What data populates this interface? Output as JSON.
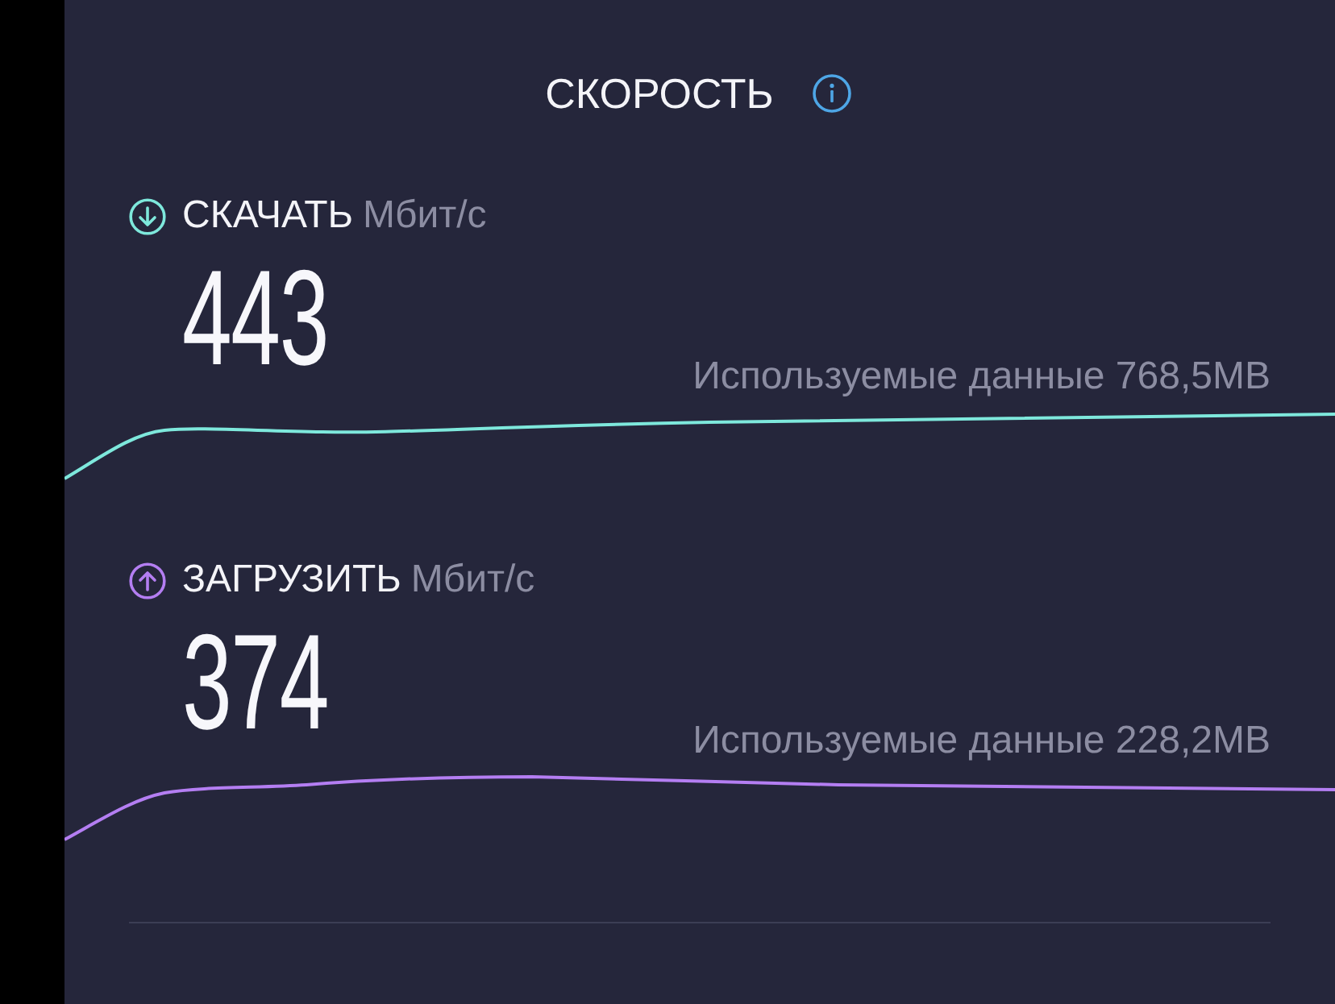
{
  "title": "СКОРОСТЬ",
  "speeds": [
    {
      "kind": "download",
      "label": "СКАЧАТЬ",
      "unit": "Мбит/с",
      "value": "443",
      "data_used": "Используемые данные 768,5MB",
      "color": "#7ee8dc"
    },
    {
      "kind": "upload",
      "label": "ЗАГРУЗИТЬ",
      "unit": "Мбит/с",
      "value": "374",
      "data_used": "Используемые данные 228,2MB",
      "color": "#b47ef2"
    }
  ]
}
